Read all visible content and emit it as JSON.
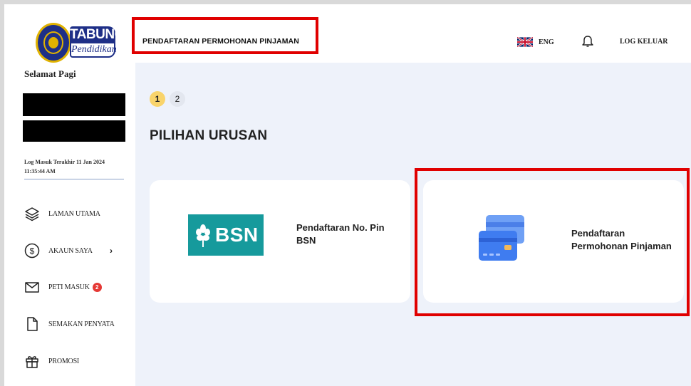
{
  "brand": {
    "logo_top": "TABUNG",
    "logo_bottom": "Pendidikan"
  },
  "header": {
    "page_title": "PENDAFTARAN PERMOHONAN PINJAMAN",
    "language": "ENG",
    "logout": "LOG KELUAR"
  },
  "sidebar": {
    "greeting": "Selamat Pagi",
    "last_login": "Log Masuk Terakhir 11 Jan 2024 11:35:44 AM",
    "items": [
      {
        "label": "LAMAN UTAMA",
        "icon": "layers-icon"
      },
      {
        "label": "AKAUN SAYA",
        "icon": "dollar-circle-icon",
        "chevron": "›"
      },
      {
        "label": "PETI MASUK",
        "icon": "mail-icon",
        "badge": "2"
      },
      {
        "label": "SEMAKAN PENYATA",
        "icon": "document-icon"
      },
      {
        "label": "PROMOSI",
        "icon": "gift-icon"
      }
    ]
  },
  "main": {
    "steps": [
      "1",
      "2"
    ],
    "active_step": "1",
    "section_title": "PILIHAN URUSAN",
    "cards": [
      {
        "label": "Pendaftaran No. Pin BSN",
        "logo_text": "BSN",
        "logo_color": "#169a9c"
      },
      {
        "label": "Pendaftaran Permohonan Pinjaman",
        "icon": "credit-cards-icon"
      }
    ]
  },
  "colors": {
    "highlight": "#e00000",
    "brand_blue": "#1e2f87",
    "brand_gold": "#e0b200",
    "step_active": "#f9d46b",
    "background": "#eef2fa"
  }
}
